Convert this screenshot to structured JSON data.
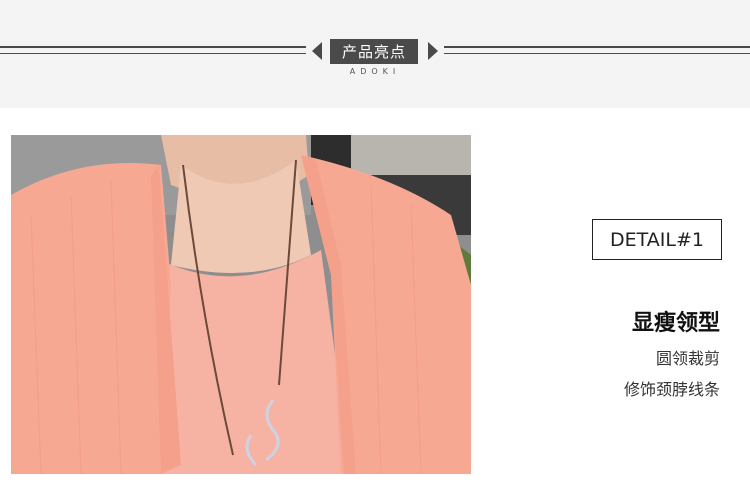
{
  "section_header": {
    "title": "产品亮点",
    "subtitle": "ADOKI"
  },
  "detail": {
    "badge": "DETAIL#1",
    "heading": "显瘦领型",
    "lines": [
      "圆领裁剪",
      "修饰颈脖线条"
    ]
  },
  "photo": {
    "subject": "model wearing pink linen cardigan over round-neck top with long pendant necklace",
    "colors": {
      "garment": "#f7a893",
      "skin": "#f0c9b4",
      "background": "#8e8e8e"
    }
  }
}
